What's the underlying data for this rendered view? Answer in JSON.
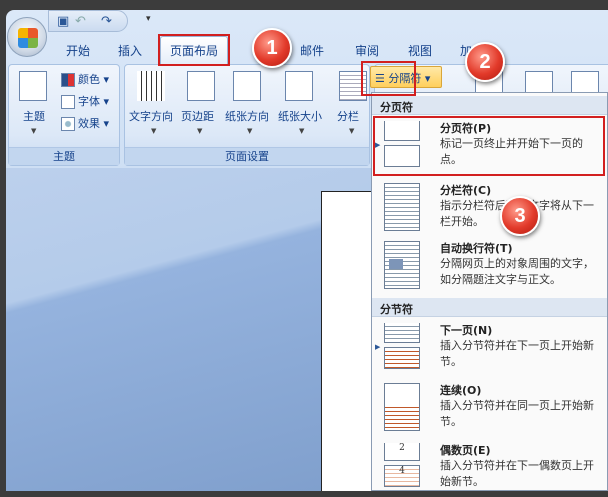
{
  "qat": {
    "icons": [
      "save-icon",
      "undo-icon",
      "redo-icon",
      "customize-qat-icon"
    ]
  },
  "tabs": [
    "开始",
    "插入",
    "页面布局",
    "邮件",
    "审阅",
    "视图",
    "加"
  ],
  "active_tab": "页面布局",
  "callouts": [
    "1",
    "2",
    "3"
  ],
  "ribbon": {
    "theme_group": {
      "label": "主题",
      "theme_button": "主题",
      "colors": "颜色",
      "fonts": "字体",
      "effects": "效果"
    },
    "page_setup_group": {
      "label": "页面设置",
      "buttons": [
        "文字方向",
        "页边距",
        "纸张方向",
        "纸张大小",
        "分栏"
      ],
      "breaks_button": "分隔符"
    }
  },
  "menu": {
    "page_breaks_header": "分页符",
    "section_breaks_header": "分节符",
    "items": [
      {
        "title": "分页符(P)",
        "desc": "标记一页终止并开始下一页的点。"
      },
      {
        "title": "分栏符(C)",
        "desc": "指示分栏符后面的文字将从下一栏开始。"
      },
      {
        "title": "自动换行符(T)",
        "desc": "分隔网页上的对象周围的文字，如分隔题注文字与正文。"
      },
      {
        "title": "下一页(N)",
        "desc": "插入分节符并在下一页上开始新节。"
      },
      {
        "title": "连续(O)",
        "desc": "插入分节符并在同一页上开始新节。"
      },
      {
        "title": "偶数页(E)",
        "desc": "插入分节符并在下一偶数页上开始新节。"
      }
    ],
    "even_page_numbers": [
      "2",
      "4"
    ]
  },
  "colors": {
    "highlight": "#d21f1f",
    "accent": "#ffcf5c"
  }
}
